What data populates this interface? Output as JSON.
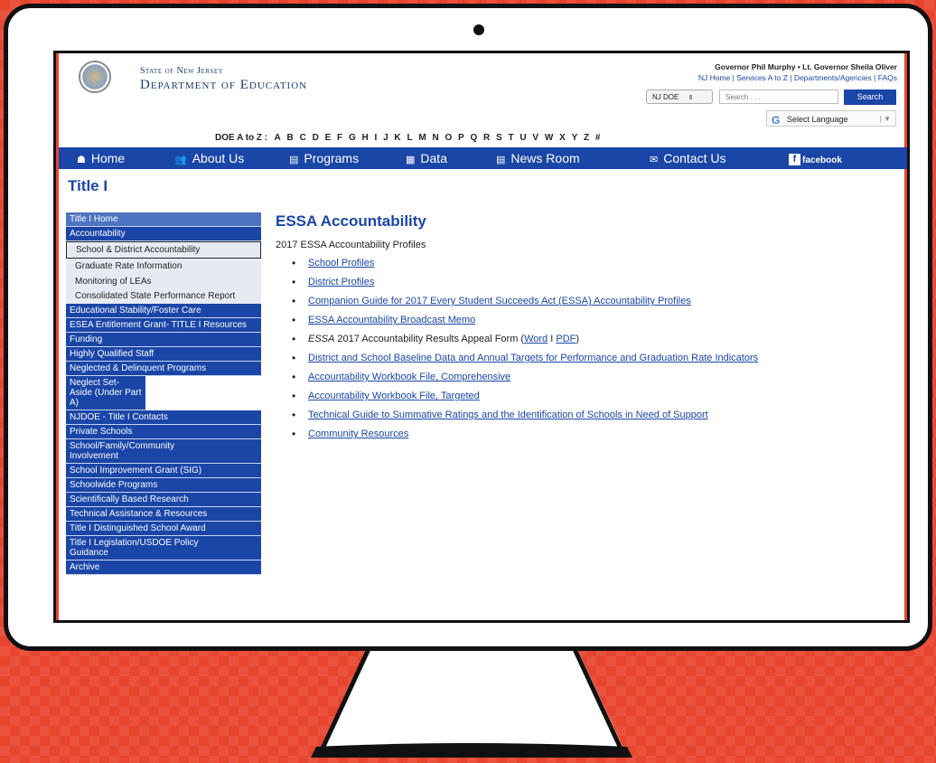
{
  "header": {
    "state_name": "State of New Jersey",
    "dept_name": "Department of Education",
    "governor_line": "Governor Phil Murphy • Lt. Governor Sheila Oliver",
    "top_links": "NJ Home | Services A to Z | Departments/Agencies | FAQs",
    "site_select_value": "NJ DOE",
    "search_placeholder": "Search . . .",
    "search_button": "Search",
    "language_button": "Select Language"
  },
  "az_bar": {
    "label": "DOE A to Z :",
    "letters": [
      "A",
      "B",
      "C",
      "D",
      "E",
      "F",
      "G",
      "H",
      "I",
      "J",
      "K",
      "L",
      "M",
      "N",
      "O",
      "P",
      "Q",
      "R",
      "S",
      "T",
      "U",
      "V",
      "W",
      "X",
      "Y",
      "Z",
      "#"
    ]
  },
  "nav": {
    "home": "Home",
    "about": "About Us",
    "programs": "Programs",
    "data": "Data",
    "news": "News Room",
    "contact": "Contact Us",
    "facebook": "facebook"
  },
  "page_title": "Title I",
  "sidebar": {
    "title_home": "Title I Home",
    "accountability": "Accountability",
    "sub_items": [
      "School & District Accountability",
      "Graduate Rate Information",
      "Monitoring of LEAs",
      "Consolidated State Performance Report"
    ],
    "items": [
      "Educational Stability/Foster Care",
      "ESEA Entitlement Grant- TITLE I Resources",
      "Funding",
      "Highly Qualified Staff",
      "Neglected & Delinquent Programs",
      "Neglect Set-Aside (Under Part A)",
      "NJDOE - Title I Contacts",
      "Private Schools",
      "School/Family/Community Involvement",
      "School Improvement Grant (SIG)",
      "Schoolwide Programs",
      "Scientifically Based Research",
      "Technical Assistance & Resources",
      "Title I Distinguished School Award",
      "Title I Legislation/USDOE Policy Guidance",
      "Archive"
    ]
  },
  "main": {
    "title": "ESSA Accountability",
    "subtitle": "2017 ESSA Accountability Profiles",
    "links": [
      "School Profiles",
      "District Profiles",
      "Companion Guide for 2017 Every Student Succeeds Act (ESSA) Accountability Profiles",
      "ESSA Accountability Broadcast Memo"
    ],
    "appeal": {
      "italic": "ESSA",
      "text": " 2017 Accountability Results Appeal Form (",
      "word": "Word",
      "sep": " I ",
      "pdf": "PDF",
      "close": ")"
    },
    "links2": [
      "District and School Baseline Data and Annual Targets for Performance and Graduation Rate Indicators",
      "Accountability Workbook File, Comprehensive",
      "Accountability Workbook File, Targeted",
      "Technical Guide to Summative Ratings and the Identification of Schools in Need of Support",
      "Community Resources"
    ]
  }
}
